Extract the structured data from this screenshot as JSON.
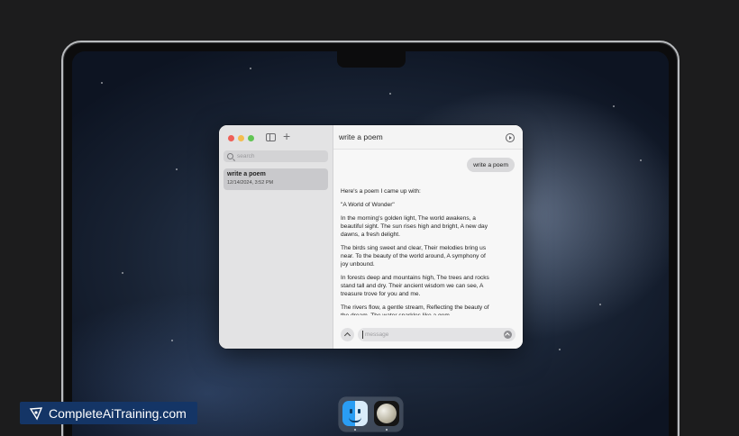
{
  "window": {
    "sidebar": {
      "search_placeholder": "search",
      "chats": [
        {
          "title": "write a poem",
          "date": "12/14/2024, 3:52 PM"
        }
      ]
    },
    "header": {
      "title": "write a poem"
    },
    "conversation": {
      "user_message": "write a poem",
      "response": [
        "Here's a poem I came up with:",
        "\"A World of Wonder\"",
        "In the morning's golden light, The world awakens, a beautiful sight. The sun rises high and bright, A new day dawns, a fresh delight.",
        "The birds sing sweet and clear, Their melodies bring us near. To the beauty of the world around, A symphony of joy unbound.",
        "In forests deep and mountains high, The trees and rocks stand tall and dry. Their ancient wisdom we can see, A treasure trove for you and me.",
        "The rivers flow, a gentle stream, Reflecting the beauty of the dream. The water sparkles like a gem"
      ]
    },
    "composer": {
      "placeholder": "message"
    }
  },
  "dock": {
    "apps": [
      "finder-icon",
      "moon-icon"
    ]
  },
  "watermark": {
    "text": "CompleteAiTraining.com"
  }
}
